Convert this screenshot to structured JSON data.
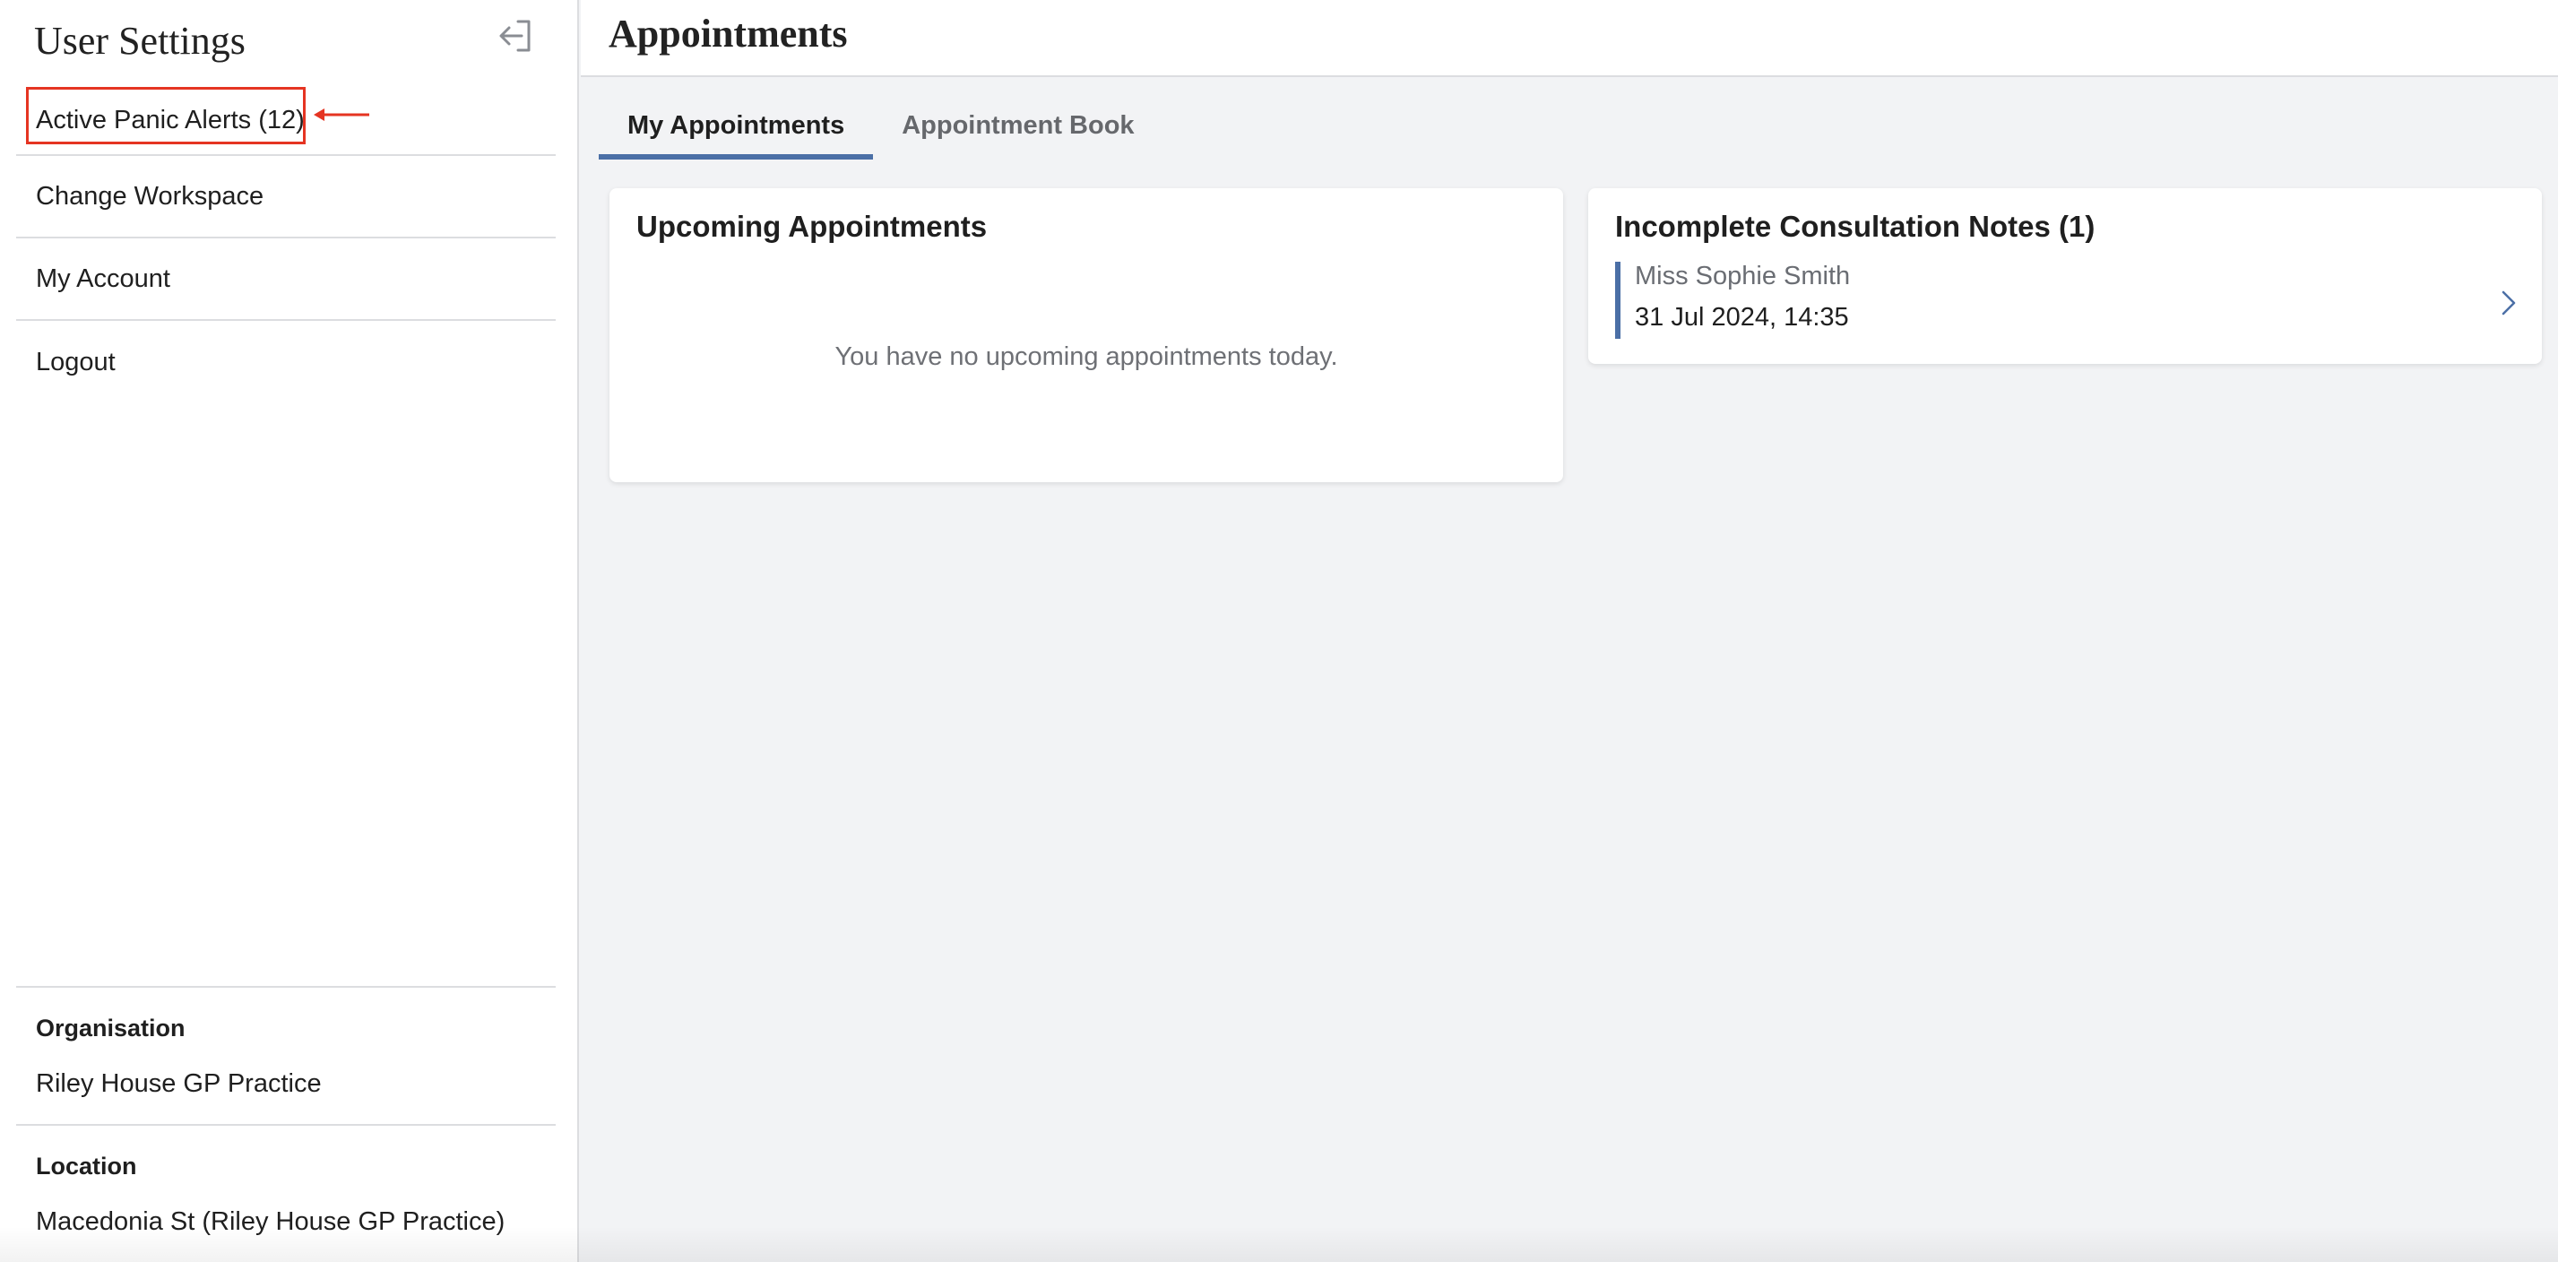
{
  "sidebar": {
    "title": "User Settings",
    "collapse_icon": "sidebar-collapse-icon",
    "items": [
      {
        "label": "Active Panic Alerts (12)"
      },
      {
        "label": "Change Workspace"
      },
      {
        "label": "My Account"
      },
      {
        "label": "Logout"
      }
    ],
    "annotation_color": "#e53422",
    "organisation": {
      "heading": "Organisation",
      "value": "Riley House GP Practice"
    },
    "location": {
      "heading": "Location",
      "value": "Macedonia St (Riley House GP Practice)"
    }
  },
  "main": {
    "page_title": "Appointments",
    "tabs": [
      {
        "label": "My Appointments",
        "active": true
      },
      {
        "label": "Appointment Book",
        "active": false
      }
    ],
    "upcoming": {
      "title": "Upcoming Appointments",
      "empty_message": "You have no upcoming appointments today."
    },
    "incomplete_notes": {
      "title": "Incomplete Consultation Notes (1)",
      "items": [
        {
          "patient": "Miss Sophie Smith",
          "datetime": "31 Jul 2024, 14:35"
        }
      ]
    }
  },
  "colors": {
    "accent": "#4b6fa6",
    "background": "#f2f3f5"
  }
}
